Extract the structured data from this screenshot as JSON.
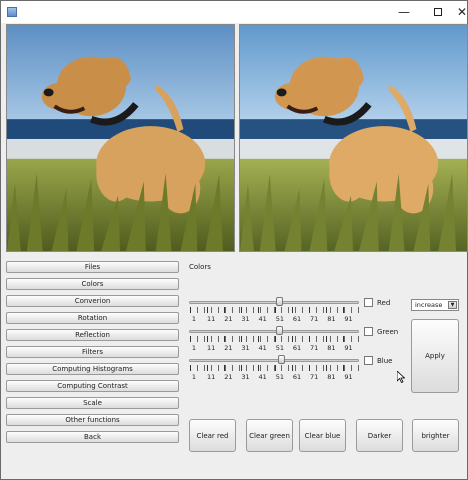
{
  "titlebar": {
    "app_icon": "window-icon",
    "minimize_symbol": "—",
    "close_symbol": "✕"
  },
  "menu": [
    {
      "label": "Files"
    },
    {
      "label": "Colors"
    },
    {
      "label": "Converion"
    },
    {
      "label": "Rotation"
    },
    {
      "label": "Reflection"
    },
    {
      "label": "Filters"
    },
    {
      "label": "Computing Histograms"
    },
    {
      "label": "Computing Contrast"
    },
    {
      "label": "Scale"
    },
    {
      "label": "Other functions"
    },
    {
      "label": "Back"
    }
  ],
  "colors_panel": {
    "title": "Colors",
    "tick_labels": [
      "1",
      "11",
      "21",
      "31",
      "41",
      "51",
      "61",
      "71",
      "81",
      "91"
    ],
    "sliders": [
      {
        "channel": "Red",
        "value": 51,
        "checked": false
      },
      {
        "channel": "Green",
        "value": 51,
        "checked": false
      },
      {
        "channel": "Blue",
        "value": 52,
        "checked": false
      }
    ],
    "mode_select": {
      "selected": "increase"
    },
    "apply_label": "Apply"
  },
  "actions": {
    "clear_red": "Clear red",
    "clear_green": "Clear green",
    "clear_blue": "Clear blue",
    "darker": "Darker",
    "brighter": "brighter"
  },
  "colors": {
    "window_bg": "#eeeeee",
    "button_border": "#9a9a9a"
  }
}
